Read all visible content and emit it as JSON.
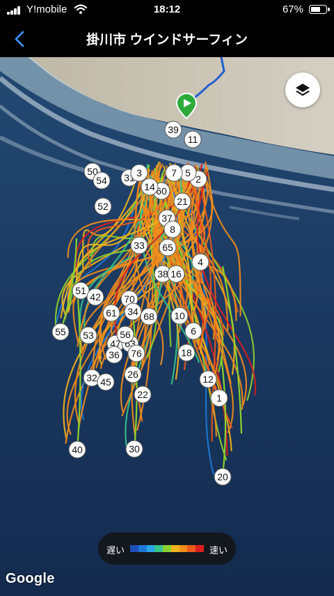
{
  "status_bar": {
    "carrier": "Y!mobile",
    "time": "18:12",
    "battery_percent": "67%",
    "battery_level": 0.67
  },
  "nav": {
    "title": "掛川市 ウインドサーフィン"
  },
  "map": {
    "start_marker_icon": "play-icon",
    "lap_markers": [
      {
        "label": "39"
      },
      {
        "label": "11"
      },
      {
        "label": "50"
      },
      {
        "label": "54"
      },
      {
        "label": "31"
      },
      {
        "label": "2"
      },
      {
        "label": "60"
      },
      {
        "label": "21"
      },
      {
        "label": "52"
      },
      {
        "label": "37"
      },
      {
        "label": "8"
      },
      {
        "label": "33"
      },
      {
        "label": "65"
      },
      {
        "label": "4"
      },
      {
        "label": "38"
      },
      {
        "label": "16"
      },
      {
        "label": "51"
      },
      {
        "label": "42"
      },
      {
        "label": "70"
      },
      {
        "label": "61"
      },
      {
        "label": "34"
      },
      {
        "label": "68"
      },
      {
        "label": "10"
      },
      {
        "label": "55"
      },
      {
        "label": "6"
      },
      {
        "label": "53"
      },
      {
        "label": "47"
      },
      {
        "label": "63"
      },
      {
        "label": "36"
      },
      {
        "label": "76"
      },
      {
        "label": "18"
      },
      {
        "label": "26"
      },
      {
        "label": "32"
      },
      {
        "label": "45"
      },
      {
        "label": "12"
      },
      {
        "label": "22"
      },
      {
        "label": "1"
      },
      {
        "label": "40"
      },
      {
        "label": "30"
      },
      {
        "label": "20"
      },
      {
        "label": "5"
      },
      {
        "label": "14"
      },
      {
        "label": "56"
      },
      {
        "label": "7"
      },
      {
        "label": "3"
      }
    ]
  },
  "layers_button_icon": "layers-icon",
  "legend": {
    "slow_label": "遅い",
    "fast_label": "速い",
    "colors": [
      "#1f4fb8",
      "#1e78d8",
      "#2aa6e6",
      "#37c48a",
      "#8bd12f",
      "#f2b51e",
      "#f28c1c",
      "#ea5a1c",
      "#d91e1e"
    ]
  },
  "attribution": "Google"
}
